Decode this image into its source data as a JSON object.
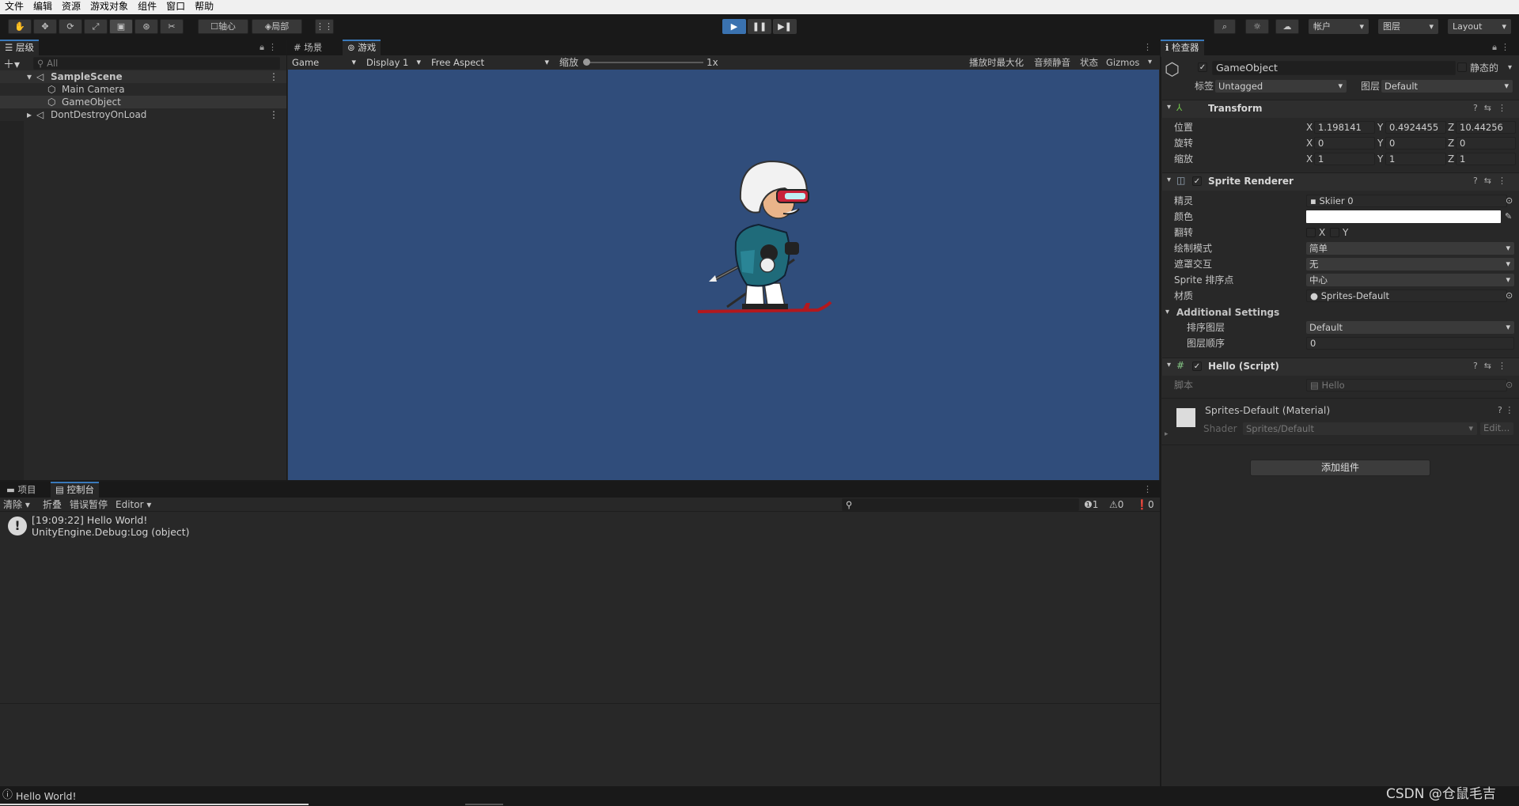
{
  "menu": [
    "文件",
    "编辑",
    "资源",
    "游戏对象",
    "组件",
    "窗口",
    "帮助"
  ],
  "toolbar": {
    "pivot": "轴心",
    "local": "局部",
    "account": "帐户",
    "layers": "图层",
    "layout": "Layout"
  },
  "hierarchy": {
    "tab": "层级",
    "search_placeholder": "All",
    "scene": "SampleScene",
    "items": [
      "Main Camera",
      "GameObject"
    ],
    "dont_destroy": "DontDestroyOnLoad"
  },
  "game_view": {
    "tab_scene": "场景",
    "tab_game": "游戏",
    "mode": "Game",
    "display": "Display 1",
    "aspect": "Free Aspect",
    "scale_label": "缩放",
    "scale_value": "1x",
    "maximize": "播放时最大化",
    "mute": "音频静音",
    "stats": "状态",
    "gizmos": "Gizmos",
    "bg_color": "#304d7b"
  },
  "inspector": {
    "tab": "检查器",
    "object_name": "GameObject",
    "static_label": "静态的",
    "tag_label": "标签",
    "tag_value": "Untagged",
    "layer_label": "图层",
    "layer_value": "Default",
    "transform": {
      "title": "Transform",
      "position_label": "位置",
      "rotation_label": "旋转",
      "scale_label": "缩放",
      "position": {
        "x": "1.198141",
        "y": "0.4924455",
        "z": "10.44256"
      },
      "rotation": {
        "x": "0",
        "y": "0",
        "z": "0"
      },
      "scale": {
        "x": "1",
        "y": "1",
        "z": "1"
      }
    },
    "sprite_renderer": {
      "title": "Sprite Renderer",
      "sprite_label": "精灵",
      "sprite_value": "Skiier 0",
      "color_label": "颜色",
      "flip_label": "翻转",
      "flip_x": "X",
      "flip_y": "Y",
      "draw_mode_label": "绘制模式",
      "draw_mode_value": "简单",
      "mask_label": "遮罩交互",
      "mask_value": "无",
      "sort_point_label": "Sprite 排序点",
      "sort_point_value": "中心",
      "material_label": "材质",
      "material_value": "Sprites-Default",
      "additional": "Additional Settings",
      "sorting_layer_label": "排序图层",
      "sorting_layer_value": "Default",
      "order_label": "图层顺序",
      "order_value": "0"
    },
    "script": {
      "title": "Hello (Script)",
      "label": "脚本",
      "value": "Hello"
    },
    "material": {
      "title": "Sprites-Default (Material)",
      "shader_label": "Shader",
      "shader_value": "Sprites/Default",
      "edit": "Edit..."
    },
    "add_component": "添加组件"
  },
  "console": {
    "tab_project": "项目",
    "tab_console": "控制台",
    "clear": "清除",
    "collapse": "折叠",
    "error_pause": "错误暂停",
    "editor": "Editor",
    "count_info": "1",
    "count_warn": "0",
    "count_error": "0",
    "log_line1": "[19:09:22] Hello World!",
    "log_line2": "UnityEngine.Debug:Log (object)"
  },
  "status": {
    "message": "Hello World!",
    "watermark": "CSDN @仓鼠毛吉"
  }
}
